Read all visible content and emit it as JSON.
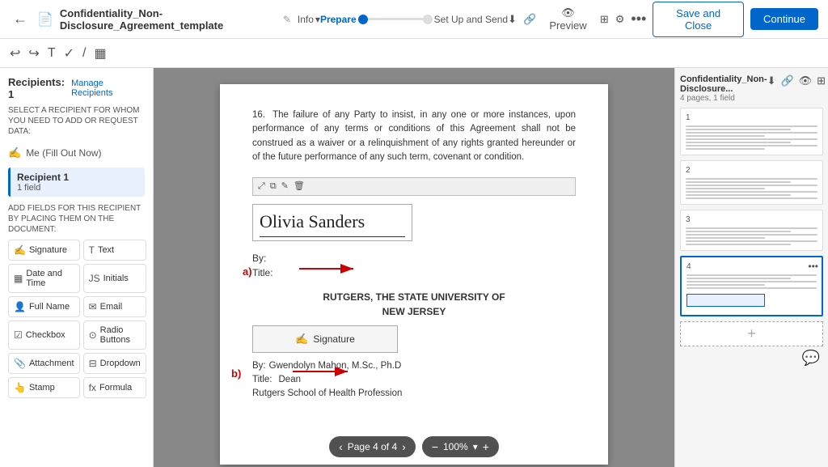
{
  "topbar": {
    "back_label": "←",
    "doc_title": "Confidentiality_Non-Disclosure_Agreement_template",
    "edit_icon": "✎",
    "info_label": "Info",
    "chevron": "▾",
    "step1": "Prepare",
    "step2": "Set Up and Send",
    "more_label": "•••",
    "save_send_label": "Save and Close",
    "continue_label": "Continue"
  },
  "toolbar2": {
    "undo": "↩",
    "redo": "↪",
    "text_icon": "T",
    "check_icon": "✓",
    "pen_icon": "/",
    "calendar_icon": "▦"
  },
  "left_panel": {
    "recipients_label": "Recipients: 1",
    "manage_label": "Manage Recipients",
    "select_label": "SELECT A RECIPIENT FOR WHOM YOU NEED TO ADD OR REQUEST DATA:",
    "me_option": "Me (Fill Out Now)",
    "recipient_name": "Recipient 1",
    "recipient_field": "1 field",
    "add_fields_label": "ADD FIELDS FOR THIS RECIPIENT BY PLACING THEM ON THE DOCUMENT:",
    "fields": [
      {
        "label": "Signature",
        "icon": "✍"
      },
      {
        "label": "Text",
        "icon": "T"
      },
      {
        "label": "Date and Time",
        "icon": "▦"
      },
      {
        "label": "Initials",
        "icon": "JS"
      },
      {
        "label": "Full Name",
        "icon": "👤"
      },
      {
        "label": "Email",
        "icon": "✉"
      },
      {
        "label": "Checkbox",
        "icon": "☑"
      },
      {
        "label": "Radio Buttons",
        "icon": "⊙"
      },
      {
        "label": "Attachment",
        "icon": "📎"
      },
      {
        "label": "Dropdown",
        "icon": "⊟"
      },
      {
        "label": "Stamp",
        "icon": "👆"
      },
      {
        "label": "Formula",
        "icon": "fx"
      }
    ]
  },
  "document": {
    "paragraph": "The failure of any Party to insist, in any one or more instances, upon performance of any terms or conditions of this Agreement shall not be construed as a waiver or a relinquishment of any rights granted hereunder or of the future performance of any such term, covenant or condition.",
    "para_num": "16.",
    "annotation_a": "a)",
    "annotation_b": "b)",
    "signature_text": "Olivia Sanders",
    "by_label_a": "By:",
    "title_label_a": "Title:",
    "org_name_line1": "RUTGERS, THE STATE UNIVERSITY OF",
    "org_name_line2": "NEW JERSEY",
    "sig_button_label": "Signature",
    "by_label_b": "By:",
    "by_value_b": "Gwendolyn Mahon, M.Sc., Ph.D",
    "title_label_b": "Title:",
    "title_value_b": "Dean",
    "school_label": "Rutgers School of Health Profession"
  },
  "bottom_bar": {
    "prev_label": "‹",
    "next_label": "›",
    "page_label": "Page 4 of 4",
    "zoom_out": "−",
    "zoom_level": "100%",
    "zoom_in": "+"
  },
  "right_panel": {
    "doc_title": "Confidentiality_Non-Disclosure...",
    "doc_sub": "4 pages, 1 field",
    "pages": [
      {
        "num": "1",
        "active": false
      },
      {
        "num": "2",
        "active": false
      },
      {
        "num": "3",
        "active": false
      },
      {
        "num": "4",
        "active": true
      }
    ],
    "add_page_label": "+"
  }
}
